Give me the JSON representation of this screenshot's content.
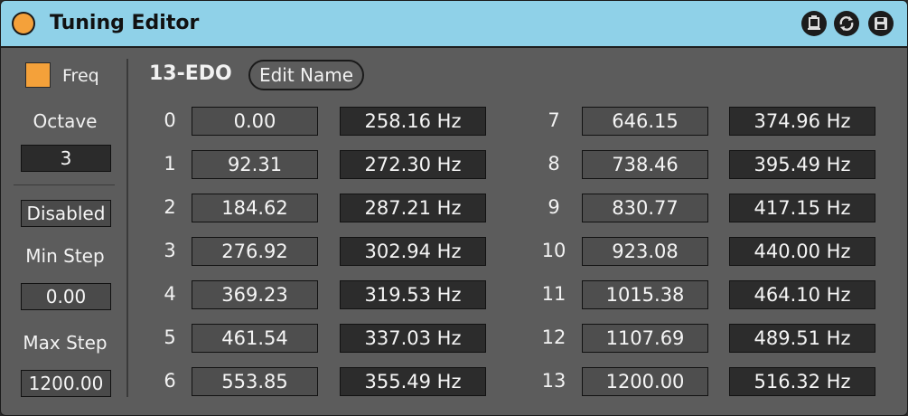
{
  "window": {
    "title": "Tuning Editor"
  },
  "titlebar_buttons": [
    {
      "icon": "screen-icon"
    },
    {
      "icon": "sync-icon"
    },
    {
      "icon": "save-icon"
    }
  ],
  "sidebar": {
    "freq_label": "Freq",
    "freq_checked": true,
    "octave_label": "Octave",
    "octave_value": "3",
    "mode_value": "Disabled",
    "min_step_label": "Min Step",
    "min_step_value": "0.00",
    "max_step_label": "Max Step",
    "max_step_value": "1200.00"
  },
  "header": {
    "tuning_name": "13-EDO",
    "edit_name_label": "Edit Name"
  },
  "steps": [
    {
      "index": "0",
      "cents": "0.00",
      "hz": "258.16 Hz"
    },
    {
      "index": "1",
      "cents": "92.31",
      "hz": "272.30 Hz"
    },
    {
      "index": "2",
      "cents": "184.62",
      "hz": "287.21 Hz"
    },
    {
      "index": "3",
      "cents": "276.92",
      "hz": "302.94 Hz"
    },
    {
      "index": "4",
      "cents": "369.23",
      "hz": "319.53 Hz"
    },
    {
      "index": "5",
      "cents": "461.54",
      "hz": "337.03 Hz"
    },
    {
      "index": "6",
      "cents": "553.85",
      "hz": "355.49 Hz"
    },
    {
      "index": "7",
      "cents": "646.15",
      "hz": "374.96 Hz"
    },
    {
      "index": "8",
      "cents": "738.46",
      "hz": "395.49 Hz"
    },
    {
      "index": "9",
      "cents": "830.77",
      "hz": "417.15 Hz"
    },
    {
      "index": "10",
      "cents": "923.08",
      "hz": "440.00 Hz"
    },
    {
      "index": "11",
      "cents": "1015.38",
      "hz": "464.10 Hz"
    },
    {
      "index": "12",
      "cents": "1107.69",
      "hz": "489.51 Hz"
    },
    {
      "index": "13",
      "cents": "1200.00",
      "hz": "516.32 Hz"
    }
  ],
  "colors": {
    "titlebar": "#8fd1e8",
    "accent": "#f4a13a",
    "panel": "#5c5c5c"
  }
}
